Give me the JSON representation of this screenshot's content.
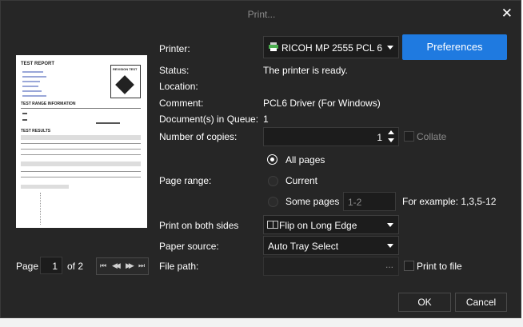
{
  "window": {
    "title": "Print...",
    "close_glyph": "✕"
  },
  "preview": {
    "doc_title": "TEST REPORT",
    "badge": "REVISION TEST",
    "section1": "TEST RANGE INFORMATION",
    "section2": "TEST RESULTS"
  },
  "pager": {
    "label": "Page",
    "current": "1",
    "of_label": "of 2",
    "first_glyph": "⏮",
    "prev_glyph": "◀◀",
    "next_glyph": "▶▶",
    "last_glyph": "⏭"
  },
  "printer": {
    "label": "Printer:",
    "selected": "RICOH MP 2555 PCL 6",
    "icon": "printer-icon"
  },
  "preferences_label": "Preferences",
  "status": {
    "label": "Status:",
    "value": "The printer is ready."
  },
  "location": {
    "label": "Location:",
    "value": ""
  },
  "comment": {
    "label": "Comment:",
    "value": "PCL6 Driver (For Windows)"
  },
  "queue": {
    "label": "Document(s) in Queue:",
    "value": "1"
  },
  "copies": {
    "label": "Number of copies:",
    "value": "1",
    "collate_label": "Collate"
  },
  "page_range": {
    "label": "Page range:",
    "options": [
      "All pages",
      "Current",
      "Some pages"
    ],
    "selected": "All pages",
    "some_pages_value": "1-2",
    "example": "For example: 1,3,5-12"
  },
  "duplex": {
    "label": "Print on both sides",
    "selected": "Flip on Long Edge"
  },
  "paper_source": {
    "label": "Paper source:",
    "selected": "Auto Tray Select"
  },
  "file_path": {
    "label": "File path:",
    "browse": "...",
    "print_to_file_label": "Print to file"
  },
  "buttons": {
    "ok": "OK",
    "cancel": "Cancel"
  },
  "colors": {
    "accent": "#1f7ae0",
    "dialog_bg": "#262626"
  }
}
